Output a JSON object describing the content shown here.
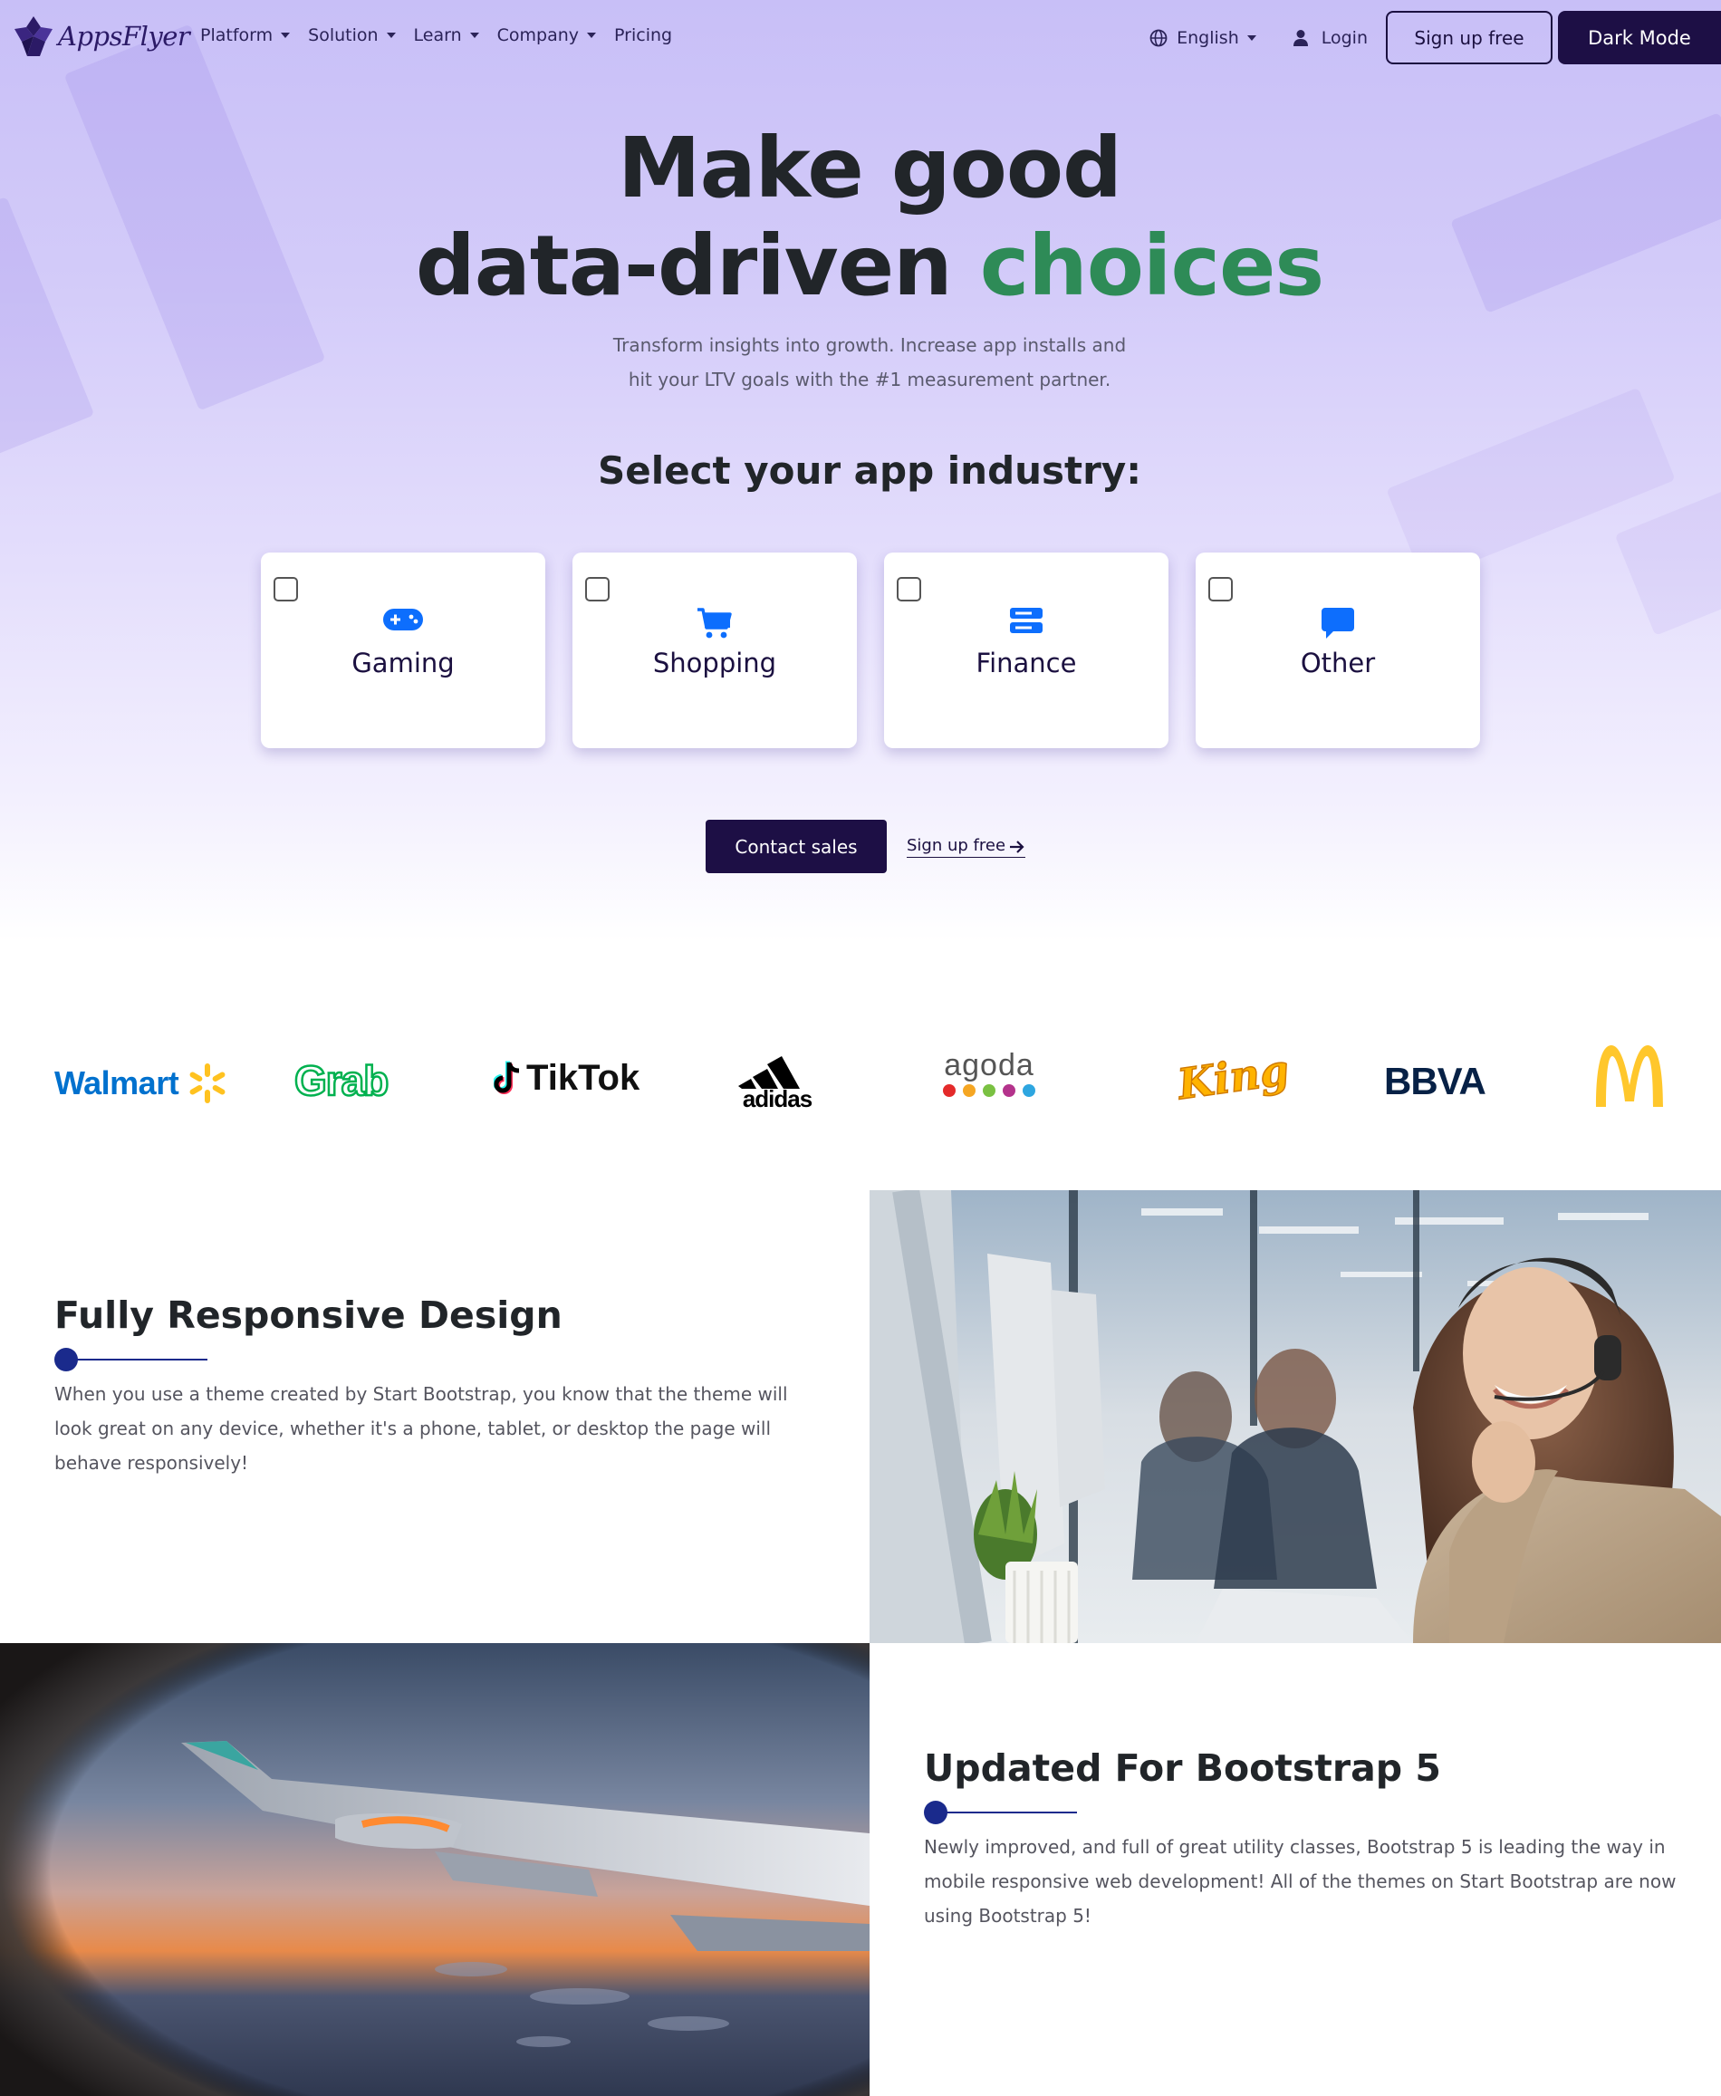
{
  "nav": {
    "brand": "AppsFlyer",
    "links": [
      "Platform",
      "Solution",
      "Learn",
      "Company",
      "Pricing"
    ],
    "language": "English",
    "login": "Login",
    "signup": "Sign up free",
    "dark_mode": "Dark Mode"
  },
  "hero": {
    "headline_line1": "Make good",
    "headline_line2_prefix": "data-driven",
    "headline_line2_accent": "choices",
    "sub_line1": "Transform insights into growth. Increase app installs and",
    "sub_line2": "hit your LTV goals with the #1 measurement partner.",
    "industry_title": "Select your app industry:",
    "industries": [
      {
        "label": "Gaming",
        "icon": "gamepad-icon"
      },
      {
        "label": "Shopping",
        "icon": "cart-icon"
      },
      {
        "label": "Finance",
        "icon": "server-icon"
      },
      {
        "label": "Other",
        "icon": "chat-icon"
      }
    ],
    "contact_sales": "Contact sales",
    "signup_link": "Sign up free"
  },
  "logos": {
    "walmart": "Walmart",
    "grab": "Grab",
    "tiktok": "TikTok",
    "adidas": "adidas",
    "agoda": "agoda",
    "king": "King",
    "bbva": "BBVA",
    "mcdonalds": "McDonald's"
  },
  "features": [
    {
      "title": "Fully Responsive Design",
      "body": "When you use a theme created by Start Bootstrap, you know that the theme will look great on any device, whether it's a phone, tablet, or desktop the page will behave responsively!"
    },
    {
      "title": "Updated For Bootstrap 5",
      "body": "Newly improved, and full of great utility classes, Bootstrap 5 is leading the way in mobile responsive web development! All of the themes on Start Bootstrap are now using Bootstrap 5!"
    }
  ],
  "colors": {
    "brand_dark": "#1d0f45",
    "accent_green": "#2e8b57",
    "icon_blue": "#0d6efd",
    "feature_line": "#1a2a8c"
  }
}
